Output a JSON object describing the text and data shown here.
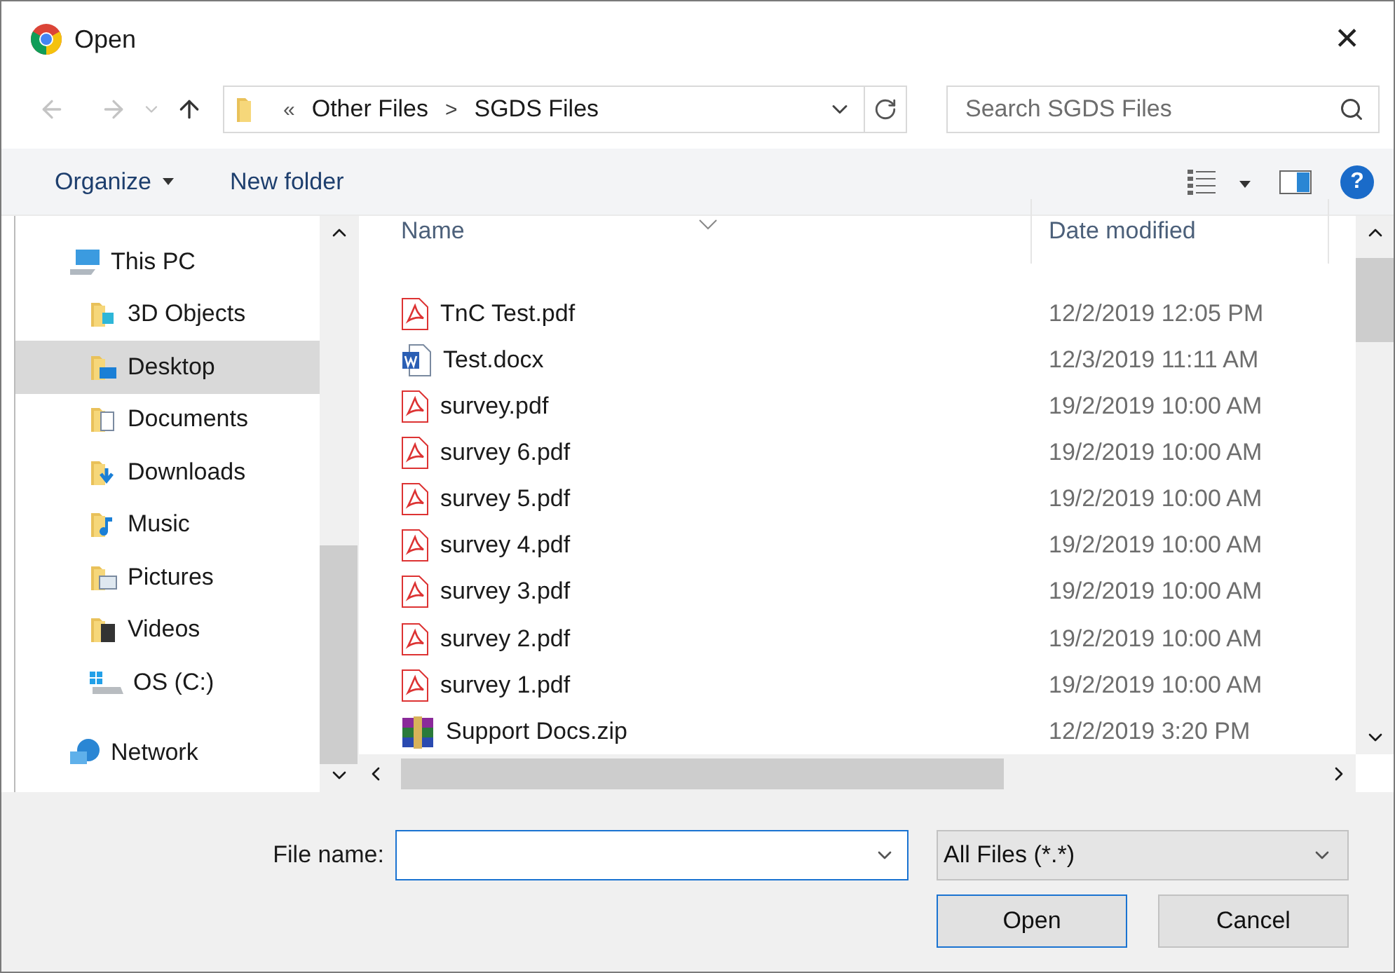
{
  "window": {
    "title": "Open",
    "close": "✕"
  },
  "address": {
    "overflow": "«",
    "path": [
      "Other Files",
      "SGDS Files"
    ],
    "separator": ">"
  },
  "search": {
    "placeholder": "Search SGDS Files"
  },
  "toolbar": {
    "organize": "Organize",
    "new_folder": "New folder",
    "help": "?"
  },
  "nav": [
    {
      "label": "This PC",
      "kind": "pc",
      "selected": false,
      "children": [
        {
          "label": "3D Objects",
          "kind": "objects",
          "selected": false
        },
        {
          "label": "Desktop",
          "kind": "desktop",
          "selected": true
        },
        {
          "label": "Documents",
          "kind": "documents",
          "selected": false
        },
        {
          "label": "Downloads",
          "kind": "downloads",
          "selected": false
        },
        {
          "label": "Music",
          "kind": "music",
          "selected": false
        },
        {
          "label": "Pictures",
          "kind": "pictures",
          "selected": false
        },
        {
          "label": "Videos",
          "kind": "videos",
          "selected": false
        },
        {
          "label": "OS (C:)",
          "kind": "drive",
          "selected": false
        }
      ]
    },
    {
      "label": "Network",
      "kind": "network",
      "selected": false
    }
  ],
  "table": {
    "columns": [
      "Name",
      "Date modified"
    ],
    "rows": [
      {
        "name": "TnC Test.pdf",
        "kind": "pdf",
        "date": "12/2/2019 12:05 PM"
      },
      {
        "name": "Test.docx",
        "kind": "docx",
        "date": "12/3/2019 11:11 AM"
      },
      {
        "name": "survey.pdf",
        "kind": "pdf",
        "date": "19/2/2019 10:00 AM"
      },
      {
        "name": "survey 6.pdf",
        "kind": "pdf",
        "date": "19/2/2019 10:00 AM"
      },
      {
        "name": "survey 5.pdf",
        "kind": "pdf",
        "date": "19/2/2019 10:00 AM"
      },
      {
        "name": "survey 4.pdf",
        "kind": "pdf",
        "date": "19/2/2019 10:00 AM"
      },
      {
        "name": "survey 3.pdf",
        "kind": "pdf",
        "date": "19/2/2019 10:00 AM"
      },
      {
        "name": "survey 2.pdf",
        "kind": "pdf",
        "date": "19/2/2019 10:00 AM"
      },
      {
        "name": "survey 1.pdf",
        "kind": "pdf",
        "date": "19/2/2019 10:00 AM"
      },
      {
        "name": "Support Docs.zip",
        "kind": "zip",
        "date": "12/2/2019 3:20 PM"
      }
    ]
  },
  "footer": {
    "file_name_label": "File name:",
    "file_type": "All Files (*.*)",
    "open": "Open",
    "cancel": "Cancel"
  }
}
